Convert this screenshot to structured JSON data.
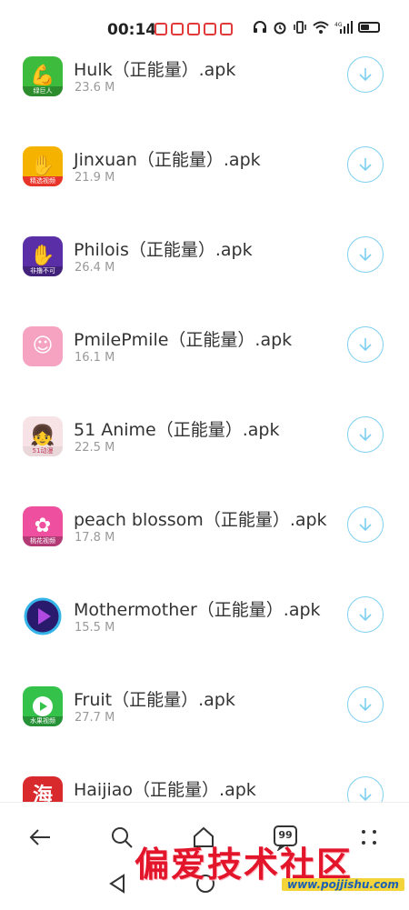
{
  "status_bar": {
    "time": "00:14",
    "notification_count": 5
  },
  "files": [
    {
      "name": "Hulk（正能量）.apk",
      "size": "23.6 M",
      "icon": "hulk-icon",
      "color": "#3dbb3d",
      "glyph": "💪",
      "tag": "绿巨人"
    },
    {
      "name": "Jinxuan（正能量）.apk",
      "size": "21.9 M",
      "icon": "jinxuan-icon",
      "color": "#f5b300",
      "glyph": "✋",
      "tag": "精选视频"
    },
    {
      "name": "Philois（正能量）.apk",
      "size": "26.4 M",
      "icon": "philois-icon",
      "color": "#5a2ea6",
      "glyph": "✋",
      "tag": "非撸不可"
    },
    {
      "name": "PmilePmile（正能量）.apk",
      "size": "16.1 M",
      "icon": "pmilepmile-icon",
      "color": "#f5a3c0",
      "glyph": "☺",
      "tag": ""
    },
    {
      "name": "51 Anime（正能量）.apk",
      "size": "22.5 M",
      "icon": "51anime-icon",
      "color": "#f7e3e6",
      "glyph": "👧",
      "tag": "51动漫"
    },
    {
      "name": "peach blossom（正能量）.apk",
      "size": "17.8 M",
      "icon": "peach-blossom-icon",
      "color": "#ee4f9e",
      "glyph": "✿",
      "tag": "桃花视频"
    },
    {
      "name": "Mothermother（正能量）.apk",
      "size": "15.5 M",
      "icon": "mothermother-icon",
      "color": "#2a1a6e",
      "glyph": "▶",
      "tag": ""
    },
    {
      "name": "Fruit（正能量）.apk",
      "size": "27.7 M",
      "icon": "fruit-icon",
      "color": "#35c24b",
      "glyph": "▶",
      "tag": "水果视频"
    },
    {
      "name": "Haijiao（正能量）.apk",
      "size": "",
      "icon": "haijiao-icon",
      "color": "#d8292c",
      "glyph": "海",
      "tag": ""
    }
  ],
  "bottom_nav": {
    "comment_count": "99"
  },
  "watermark": {
    "title": "偏爱技术社区",
    "url": "www.pojjishu.com"
  },
  "colors": {
    "download_ring": "#7fd0f0",
    "watermark_red": "#e2152b"
  }
}
